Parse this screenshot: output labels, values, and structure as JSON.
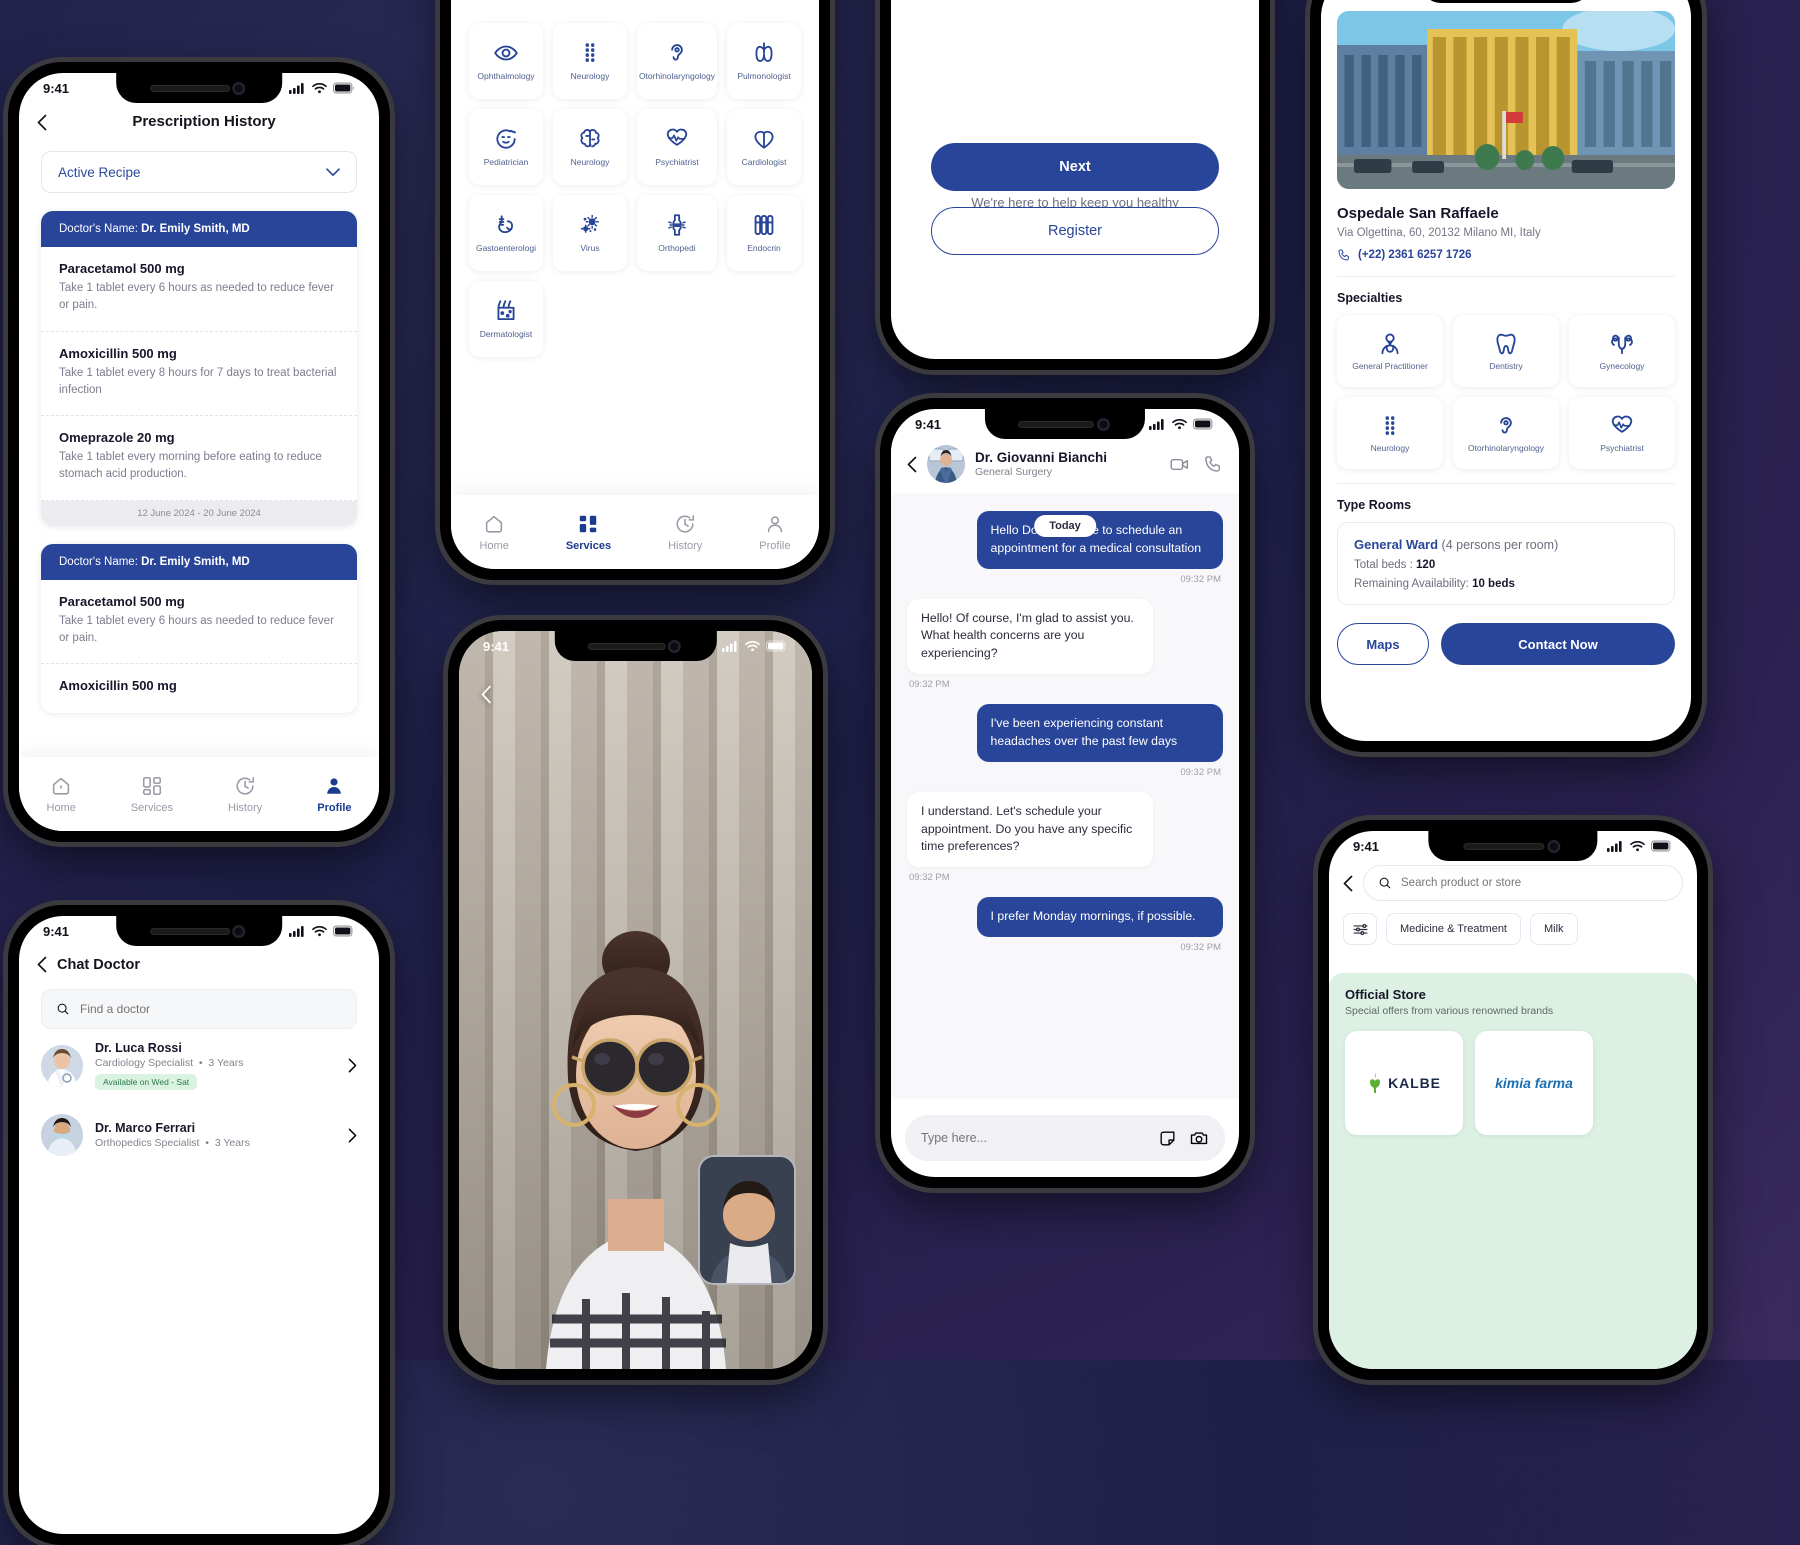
{
  "status_bar": {
    "time": "9:41"
  },
  "prescription": {
    "title": "Prescription History",
    "filter_label": "Active Recipe",
    "cards": [
      {
        "doctor_label": "Doctor's Name:",
        "doctor_name": "Dr. Emily Smith, MD",
        "date_range": "12 June 2024 - 20 June 2024",
        "items": [
          {
            "name": "Paracetamol 500 mg",
            "desc": "Take 1 tablet every 6 hours as needed to reduce fever or pain."
          },
          {
            "name": "Amoxicillin 500 mg",
            "desc": "Take 1 tablet every 8 hours for 7 days to treat bacterial infection"
          },
          {
            "name": "Omeprazole 20 mg",
            "desc": "Take 1 tablet every morning before eating to reduce stomach acid production."
          }
        ]
      },
      {
        "doctor_label": "Doctor's Name:",
        "doctor_name": "Dr. Emily Smith, MD",
        "date_range": "",
        "items": [
          {
            "name": "Paracetamol 500 mg",
            "desc": "Take 1 tablet every 6 hours as needed to reduce fever or pain."
          },
          {
            "name": "Amoxicillin 500 mg",
            "desc": ""
          }
        ]
      }
    ]
  },
  "tabbar": [
    {
      "label": "Home",
      "icon": "home-icon",
      "active": false
    },
    {
      "label": "Services",
      "icon": "grid-icon",
      "active": false
    },
    {
      "label": "History",
      "icon": "history-icon",
      "active": false
    },
    {
      "label": "Profile",
      "icon": "person-icon",
      "active": true
    }
  ],
  "tabbar_services": [
    {
      "label": "Home",
      "icon": "home-icon",
      "active": false
    },
    {
      "label": "Services",
      "icon": "grid-icon",
      "active": true
    },
    {
      "label": "History",
      "icon": "history-icon",
      "active": false
    },
    {
      "label": "Profile",
      "icon": "person-icon",
      "active": false
    }
  ],
  "services": {
    "items": [
      {
        "label": "Ophthalmology",
        "icon": "eye-icon"
      },
      {
        "label": "Neurology",
        "icon": "spine-icon"
      },
      {
        "label": "Otorhinolaryngology",
        "icon": "ear-icon"
      },
      {
        "label": "Pulmonologist",
        "icon": "lungs-icon"
      },
      {
        "label": "Pediatrician",
        "icon": "child-face-icon"
      },
      {
        "label": "Neurology",
        "icon": "brain-icon"
      },
      {
        "label": "Psychiatrist",
        "icon": "heart-pulse-icon"
      },
      {
        "label": "Cardiologist",
        "icon": "heart-icon"
      },
      {
        "label": "Gastoenterologi",
        "icon": "stomach-icon"
      },
      {
        "label": "Virus",
        "icon": "virus-icon"
      },
      {
        "label": "Orthopedi",
        "icon": "joint-icon"
      },
      {
        "label": "Endocrin",
        "icon": "vials-icon"
      },
      {
        "label": "Dermatologist",
        "icon": "skin-icon"
      }
    ]
  },
  "welcome": {
    "subtitle": "We're here to help keep you healthy",
    "next_label": "Next",
    "register_label": "Register"
  },
  "chat": {
    "doctor_name": "Dr. Giovanni Bianchi",
    "doctor_role": "General Surgery",
    "day_label": "Today",
    "messages": [
      {
        "side": "out",
        "text": "Hello Doctor, I'd like to schedule an appointment for a medical consultation",
        "time": "09:32 PM"
      },
      {
        "side": "in",
        "text": "Hello! Of course, I'm glad to assist you. What health concerns are you experiencing?",
        "time": "09:32 PM"
      },
      {
        "side": "out",
        "text": "I've been experiencing constant headaches over the past few days",
        "time": "09:32 PM"
      },
      {
        "side": "in",
        "text": "I understand. Let's schedule your appointment. Do you have any specific time preferences?",
        "time": "09:32 PM"
      },
      {
        "side": "out",
        "text": "I prefer Monday mornings, if possible.",
        "time": "09:32 PM"
      }
    ],
    "composer_placeholder": "Type here..."
  },
  "hospital": {
    "name": "Ospedale San Raffaele",
    "address": "Via Olgettina, 60, 20132 Milano MI, Italy",
    "phone": "(+22) 2361 6257 1726",
    "specialties_title": "Specialties",
    "specialties": [
      {
        "label": "General Practitioner",
        "icon": "doctor-icon"
      },
      {
        "label": "Dentistry",
        "icon": "tooth-icon"
      },
      {
        "label": "Gynecology",
        "icon": "uterus-icon"
      },
      {
        "label": "Neurology",
        "icon": "spine-icon"
      },
      {
        "label": "Otorhinolaryngology",
        "icon": "ear-icon"
      },
      {
        "label": "Psychiatrist",
        "icon": "heart-pulse-icon"
      }
    ],
    "rooms_title": "Type Rooms",
    "room": {
      "name": "General Ward",
      "occupancy": "(4 persons per room)",
      "total_beds_label": "Total beds :",
      "total_beds": "120",
      "remaining_label": "Remaining Availability:",
      "remaining": "10 beds"
    },
    "maps_label": "Maps",
    "contact_label": "Contact Now"
  },
  "chat_doctor": {
    "title": "Chat Doctor",
    "search_placeholder": "Find a doctor",
    "doctors": [
      {
        "name": "Dr. Luca Rossi",
        "spec": "Cardiology Specialist",
        "exp": "3 Years",
        "badge": "Available on Wed - Sat"
      },
      {
        "name": "Dr. Marco Ferrari",
        "spec": "Orthopedics Specialist",
        "exp": "3 Years",
        "badge": ""
      }
    ]
  },
  "store": {
    "search_placeholder": "Search product or store",
    "chips": [
      "Medicine & Treatment",
      "Milk"
    ],
    "panel_title": "Official Store",
    "panel_subtitle": "Special offers from various renowned brands",
    "brands": [
      "KALBE",
      "kimia farma"
    ]
  },
  "colors": {
    "primary": "#29459a",
    "bg": "#1e2048",
    "accent": "#2b4a9e"
  }
}
